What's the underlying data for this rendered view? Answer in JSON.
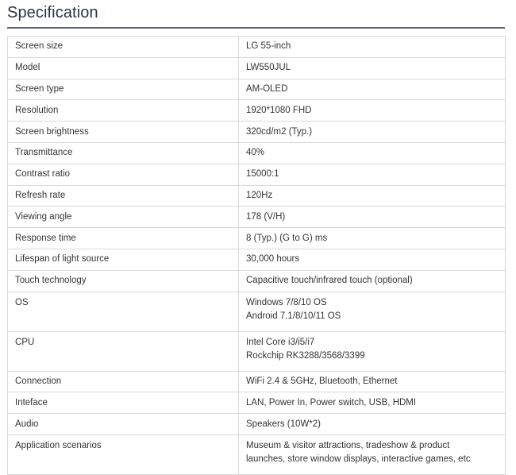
{
  "title": "Specification",
  "rows": [
    {
      "label": "Screen size",
      "value": [
        "LG 55-inch"
      ]
    },
    {
      "label": "Model",
      "value": [
        "LW550JUL"
      ]
    },
    {
      "label": "Screen type",
      "value": [
        "AM-OLED"
      ]
    },
    {
      "label": "Resolution",
      "value": [
        "1920*1080 FHD"
      ]
    },
    {
      "label": "Screen brightness",
      "value": [
        "320cd/m2 (Typ.)"
      ]
    },
    {
      "label": "Transmittance",
      "value": [
        "40%"
      ]
    },
    {
      "label": "Contrast ratio",
      "value": [
        "15000:1"
      ]
    },
    {
      "label": "Refresh rate",
      "value": [
        "120Hz"
      ]
    },
    {
      "label": "Viewing angle",
      "value": [
        "178 (V/H)"
      ]
    },
    {
      "label": "Response time",
      "value": [
        "8 (Typ.) (G to G) ms"
      ]
    },
    {
      "label": "Lifespan of light source",
      "value": [
        "30,000 hours"
      ]
    },
    {
      "label": "Touch technology",
      "value": [
        "Capacitive touch/infrared touch (optional)"
      ]
    },
    {
      "label": "OS",
      "value": [
        "Windows 7/8/10 OS",
        "Android 7.1/8/10/11 OS"
      ]
    },
    {
      "label": "CPU",
      "value": [
        "Intel Core i3/i5/i7",
        "Rockchip RK3288/3568/3399"
      ]
    },
    {
      "label": "Connection",
      "value": [
        "WiFi 2.4 & 5GHz, Bluetooth, Ethernet"
      ]
    },
    {
      "label": "Inteface",
      "value": [
        "LAN, Power In, Power switch, USB, HDMI"
      ]
    },
    {
      "label": "Audio",
      "value": [
        "Speakers (10W*2)"
      ]
    },
    {
      "label": "Application scenarios",
      "value": [
        "Museum & visitor attractions, tradeshow & product",
        "launches, store window displays, interactive games, etc"
      ]
    }
  ]
}
